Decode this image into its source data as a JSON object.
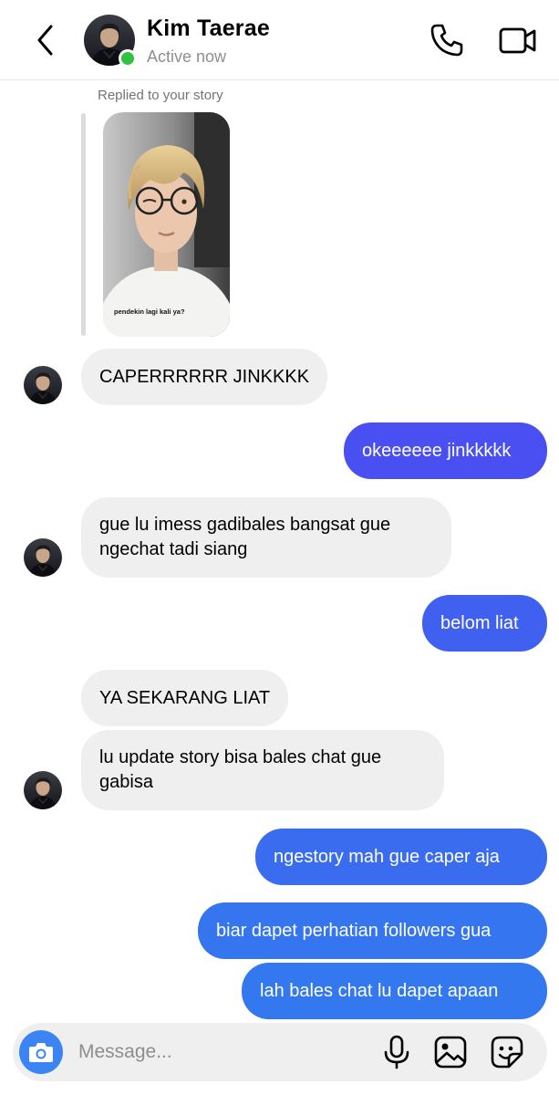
{
  "header": {
    "name": "Kim Taerae",
    "status": "Active now"
  },
  "story_reply": {
    "caption": "Replied to your story",
    "story_text": "pendekin lagi kali ya?"
  },
  "messages": [
    {
      "from": "them",
      "text": "CAPERRRRRR JINKKKK"
    },
    {
      "from": "me",
      "text": "okeeeeee jinkkkkk"
    },
    {
      "from": "them",
      "text": "gue lu imess gadibales bangsat gue\nngechat tadi siang"
    },
    {
      "from": "me",
      "text": "belom liat"
    },
    {
      "from": "them",
      "text": "YA SEKARANG LIAT"
    },
    {
      "from": "them",
      "text": "lu update story bisa bales chat gue\ngabisa"
    },
    {
      "from": "me",
      "text": "ngestory mah gue caper aja"
    },
    {
      "from": "me",
      "text": "biar dapet perhatian followers gua"
    },
    {
      "from": "me",
      "text": "lah bales chat lu dapet apaan"
    }
  ],
  "composer": {
    "placeholder": "Message..."
  },
  "icons": {
    "back": "chevron-left-icon",
    "call": "phone-icon",
    "video": "video-camera-icon",
    "camera": "camera-icon",
    "mic": "microphone-icon",
    "gallery": "image-icon",
    "sticker": "sticker-icon"
  },
  "colors": {
    "online": "#2fc13f",
    "incoming_bubble": "#efefef",
    "outgoing_purple": "#4a4ff2",
    "outgoing_blue": "#3478f0",
    "camera_button": "#3a85f3"
  }
}
